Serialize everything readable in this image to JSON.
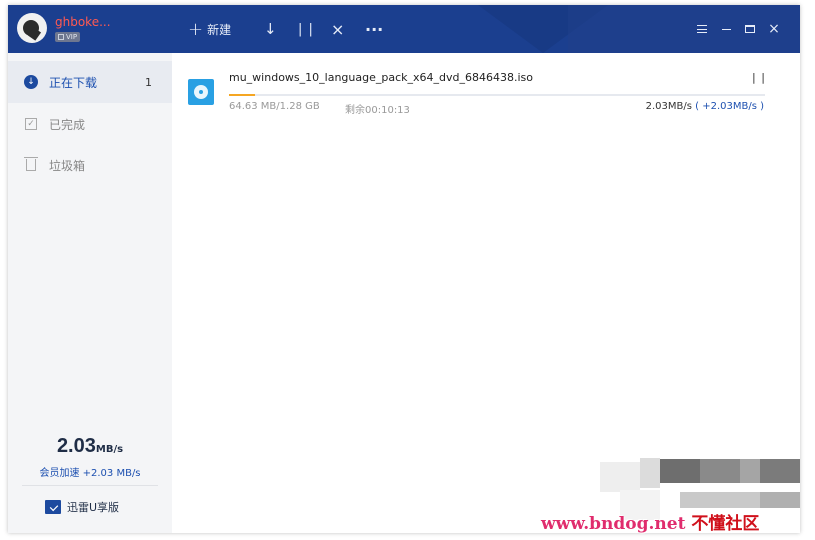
{
  "titlebar": {
    "username": "ghboke...",
    "vip_badge": "VIP",
    "new_label": "新建",
    "new_icon": "plus-icon",
    "download_icon": "arrow-down-icon",
    "pause_icon": "pause-icon",
    "delete_icon": "close-icon",
    "more_icon": "more-icon",
    "menu_icon": "hamburger-icon",
    "minimize_icon": "minimize-icon",
    "maximize_icon": "maximize-icon",
    "close_icon": "close-icon",
    "bg_color": "#1b3f8f"
  },
  "sidebar": {
    "items": [
      {
        "label": "正在下载",
        "count": "1",
        "icon": "download-circle-icon",
        "active": true
      },
      {
        "label": "已完成",
        "count": "",
        "icon": "check-box-icon",
        "active": false
      },
      {
        "label": "垃圾箱",
        "count": "",
        "icon": "trash-icon",
        "active": false
      }
    ],
    "speed_value": "2.03",
    "speed_unit": "MB/s",
    "vip_speed": "会员加速 +2.03 MB/s",
    "u_version": "迅雷U享版"
  },
  "tasks": [
    {
      "filename": "mu_windows_10_language_pack_x64_dvd_6846438.iso",
      "size": "64.63 MB/1.28 GB",
      "remaining": "剩余00:10:13",
      "speed": "2.03MB/s",
      "boost": "( +2.03MB/s )",
      "progress_percent": 4.9,
      "file_icon": "disc-image-icon"
    }
  ],
  "watermark": {
    "url": "www.bndog.net",
    "name": "不懂社区"
  },
  "colors": {
    "accent": "#1d50b0",
    "progress": "#f5a623",
    "username": "#ff5a52"
  }
}
